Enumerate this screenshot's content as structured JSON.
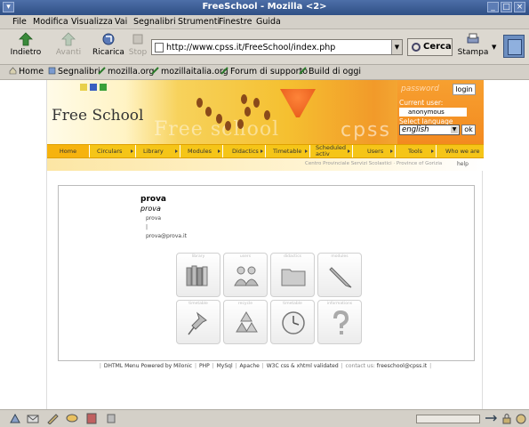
{
  "window": {
    "title": "FreeSchool - Mozilla <2>"
  },
  "menubar": [
    "File",
    "Modifica",
    "Visualizza",
    "Vai",
    "Segnalibri",
    "Strumenti",
    "Finestre",
    "Guida"
  ],
  "nav": {
    "back": "Indietro",
    "forward": "Avanti",
    "reload": "Ricarica",
    "stop": "Stop",
    "url": "http://www.cpss.it/FreeSchool/index.php",
    "search": "Cerca",
    "print": "Stampa"
  },
  "bookmarks": [
    "Home",
    "Segnalibri",
    "mozilla.org",
    "mozillaitalia.org",
    "Forum di supporto",
    "Build di oggi"
  ],
  "site": {
    "banner_text": "Free School",
    "banner_watermark": "Free school",
    "banner_cpss": "cpss",
    "login": {
      "button": "login",
      "password_hint": "password",
      "current_user_label": "Current user:",
      "current_user": "anonymous",
      "select_language_label": "Select language",
      "language": "english",
      "ok": "ok"
    },
    "menu": [
      "Home",
      "Circulars",
      "Library",
      "Modules",
      "Didactics",
      "Timetable",
      "Scheduled activ",
      "Users",
      "Tools",
      "Who we are"
    ],
    "breadcrumb": "Centro Provinciale Servizi Scolastici · Province of Gorizia",
    "help": "help",
    "profile": {
      "name": "prova",
      "subtitle": "prova",
      "lines": [
        "prova",
        "|",
        "prova@prova.it"
      ]
    },
    "tiles": [
      "library",
      "users",
      "didactics",
      "modules",
      "timetable",
      "recycle",
      "timetable",
      "informations"
    ],
    "footer": {
      "items": [
        "DHTML Menu Powered by Milonic",
        "PHP",
        "MySql",
        "Apache",
        "W3C css & xhtml validated",
        "contact us:",
        "freeschool@cpss.it"
      ]
    }
  },
  "colors": {
    "menu_yellow": "#f5c518",
    "login_orange": "#f38a20",
    "title_blue": "#2f4f85"
  }
}
